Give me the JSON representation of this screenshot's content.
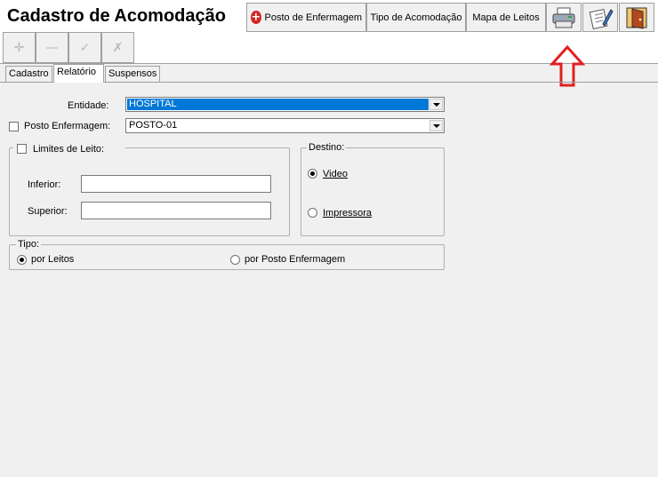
{
  "header": {
    "title": "Cadastro de Acomodação",
    "buttons": {
      "posto": "Posto de Enfermagem",
      "tipo": "Tipo de Acomodação",
      "mapa": "Mapa de Leitos"
    },
    "icon_buttons": [
      "printer-icon",
      "edit-report-icon",
      "exit-door-icon"
    ],
    "annotation_color": "#e02020"
  },
  "tabs": [
    "Cadastro",
    "Relatório",
    "Suspensos"
  ],
  "active_tab": "Relatório",
  "form": {
    "entidade_label": "Entidade:",
    "entidade_value": "HOSPITAL",
    "posto_label": "Posto Enfermagem:",
    "posto_value": "POSTO-01",
    "limites_label": "Limites de Leito:",
    "inferior_label": "Inferior:",
    "superior_label": "Superior:",
    "inferior_value": "",
    "superior_value": "",
    "destino_label": "Destino:",
    "destino_video": "Video",
    "destino_impressora": "Impressora",
    "tipo_label": "Tipo:",
    "tipo_leitos": "por Leitos",
    "tipo_posto": "por Posto Enfermagem"
  }
}
